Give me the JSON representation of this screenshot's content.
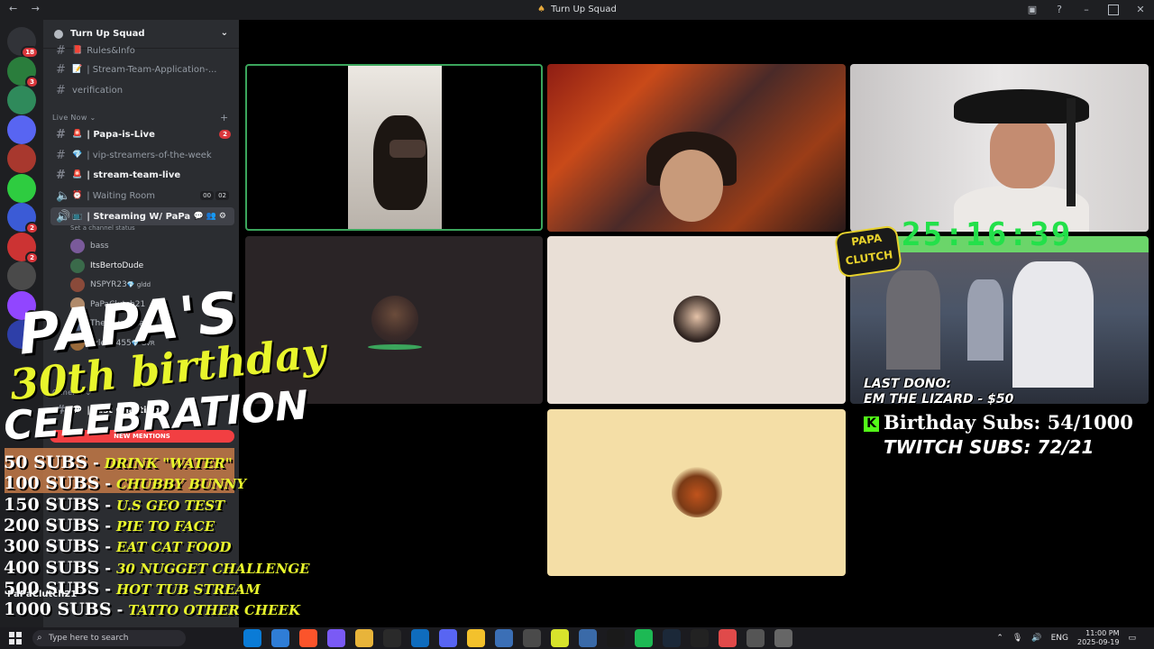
{
  "window": {
    "nav": "← →",
    "title": "Turn Up Squad"
  },
  "servers": [
    {
      "name": "home",
      "color": "#313338",
      "badge": "18"
    },
    {
      "name": "s1",
      "color": "#2a7d3c",
      "badge": "3"
    },
    {
      "name": "s2",
      "color": "#2f8a5b",
      "badge": ""
    },
    {
      "name": "s3",
      "color": "#5865f2",
      "badge": ""
    },
    {
      "name": "s4",
      "color": "#a8382e",
      "badge": ""
    },
    {
      "name": "s5",
      "color": "#2ecc40",
      "badge": ""
    },
    {
      "name": "s6",
      "color": "#3b5bd6",
      "badge": "2"
    },
    {
      "name": "s7",
      "color": "#cc3333",
      "badge": "2"
    },
    {
      "name": "s8",
      "color": "#4a4a4a",
      "badge": ""
    },
    {
      "name": "s9",
      "color": "#9146ff",
      "badge": "2"
    },
    {
      "name": "s10",
      "color": "#2e3fa8",
      "badge": ""
    }
  ],
  "guild": {
    "name": "Turn Up Squad"
  },
  "channels_top": [
    {
      "label": "Rules&Info",
      "type": "text"
    },
    {
      "label": "| Stream-Team-Application-...",
      "type": "text"
    },
    {
      "label": "verification",
      "type": "text"
    }
  ],
  "category_live": "Live Now",
  "channels_live": [
    {
      "label": "| Papa-is-Live",
      "badge": "2",
      "bold": true
    },
    {
      "label": "| vip-streamers-of-the-week",
      "badge": "",
      "bold": false
    },
    {
      "label": "| stream-team-live",
      "badge": "",
      "bold": true
    }
  ],
  "voice_waiting": {
    "label": "| Waiting Room",
    "count_a": "00",
    "count_b": "02"
  },
  "voice_streaming": {
    "label": "| Streaming W/ PaPa",
    "status": "Set a channel status"
  },
  "voice_users": [
    {
      "name": "bass",
      "color": "#7a5a9a"
    },
    {
      "name": "ItsBertoDude",
      "color": "#3a6a4a"
    },
    {
      "name": "NSPYR23",
      "color": "#8a4a3a",
      "tag": "gldd"
    },
    {
      "name": "PaPaClutch21",
      "color": "#b08a6a"
    },
    {
      "name": "TheSherminator",
      "color": "#5a6a8a"
    },
    {
      "name": "tylerlo455",
      "color": "#9a6a3a",
      "tag": "GVR"
    }
  ],
  "category_general": "General",
  "channel_general": "| Just Chatting",
  "overlay": {
    "line1": "PAPA'S",
    "line2": "30th birthday",
    "line3": "CELEBRATION",
    "mentions": "NEW MENTIONS",
    "goals": [
      {
        "subs": "50 SUBS",
        "reward": "DRINK \"WATER\""
      },
      {
        "subs": "100 SUBS",
        "reward": "CHUBBY BUNNY"
      },
      {
        "subs": "150 SUBS",
        "reward": "U.S GEO TEST"
      },
      {
        "subs": "200 SUBS",
        "reward": "PIE TO FACE"
      },
      {
        "subs": "300 SUBS",
        "reward": "EAT CAT FOOD"
      },
      {
        "subs": "400 SUBS",
        "reward": "30 NUGGET CHALLENGE"
      },
      {
        "subs": "500 SUBS",
        "reward": "HOT TUB STREAM"
      },
      {
        "subs": "1000 SUBS",
        "reward": "TATTO OTHER CHEEK"
      }
    ],
    "user": "PaPaClutch21"
  },
  "stream": {
    "timer": "25:16:39",
    "logo": "PAPA CLUTCH",
    "last_dono_label": "LAST DONO:",
    "last_dono_value": "EM THE LIZARD - $50",
    "kick_icon": "K",
    "birthday_subs": "Birthday Subs: 54/1000",
    "twitch_subs": "TWITCH SUBS: 72/21"
  },
  "taskbar": {
    "search_placeholder": "Type here to search",
    "lang": "ENG",
    "time": "11:00 PM",
    "date": "2025-09-19"
  }
}
